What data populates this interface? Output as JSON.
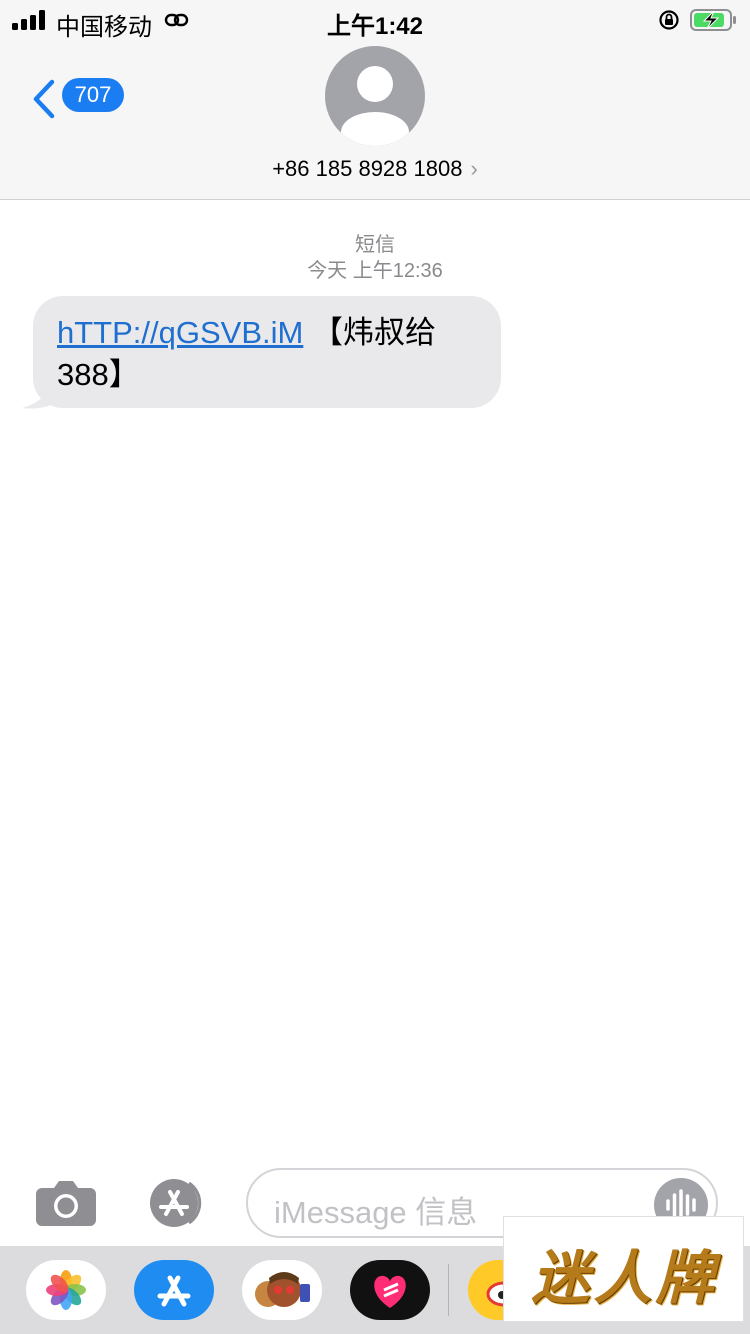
{
  "status_bar": {
    "carrier": "中国移动",
    "time": "上午1:42",
    "battery_charging": true,
    "signal_bars": 4
  },
  "header": {
    "back_count": "707",
    "contact": "+86 185 8928 1808",
    "chevron": "›",
    "icons": {
      "back": "chevron-left-icon",
      "avatar": "person-avatar-icon"
    }
  },
  "conversation": {
    "service": "短信",
    "timestamp": "今天 上午12:36",
    "messages": [
      {
        "direction": "incoming",
        "link_text": "hTTP://qGSVB.iM",
        "text_after": " 【炜叔给388】"
      }
    ]
  },
  "input": {
    "placeholder": "iMessage 信息",
    "icons": {
      "camera": "camera-icon",
      "apps": "app-store-icon",
      "audio": "audio-waveform-icon"
    }
  },
  "app_drawer": {
    "apps": [
      "photos-icon",
      "app-store-icon",
      "memoji-icon",
      "heart-sticker-icon",
      "weibo-icon"
    ]
  },
  "watermark": {
    "text": "迷人牌"
  },
  "colors": {
    "accent": "#1a7df2",
    "bubble": "#e9e9eb",
    "link": "#1f6fd0",
    "bar_bg": "#f6f6f6",
    "battery_fill": "#4cd964"
  }
}
